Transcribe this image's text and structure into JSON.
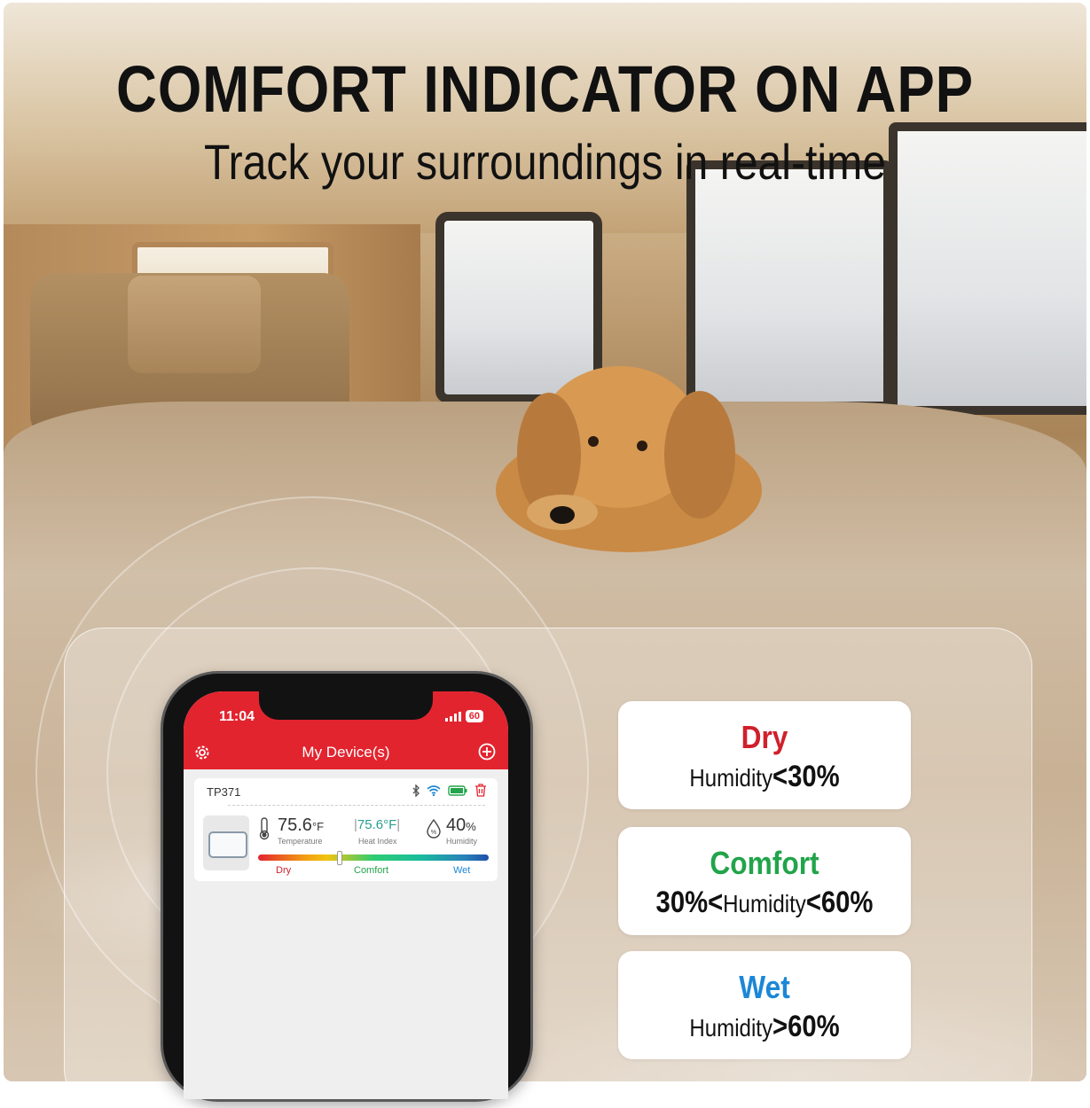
{
  "headline": {
    "title": "COMFORT INDICATOR ON APP",
    "subtitle": "Track your surroundings in real-time"
  },
  "phone": {
    "status_time": "11:04",
    "battery": "60",
    "app_title": "My Device(s)",
    "device": {
      "name": "TP371",
      "temperature_value": "75.6",
      "temperature_unit": "°F",
      "temperature_label": "Temperature",
      "heat_index_value": "75.6°F",
      "heat_index_label": "Heat Index",
      "humidity_value": "40",
      "humidity_unit": "%",
      "humidity_label": "Humidity",
      "scale_labels": {
        "dry": "Dry",
        "comfort": "Comfort",
        "wet": "Wet"
      },
      "indicator_position": 0.35
    }
  },
  "legend": [
    {
      "title": "Dry",
      "color": "#d0202c",
      "prefix": "",
      "middle": "Humidity",
      "suffix": "<30%"
    },
    {
      "title": "Comfort",
      "color": "#22a44a",
      "prefix": "30%<",
      "middle": "Humidity",
      "suffix": "<60%"
    },
    {
      "title": "Wet",
      "color": "#1c87d6",
      "prefix": "",
      "middle": "Humidity",
      "suffix": ">60%"
    }
  ],
  "colors": {
    "accent": "#e2242f",
    "dry": "#d0202c",
    "comfort": "#22a44a",
    "wet": "#1c87d6"
  }
}
